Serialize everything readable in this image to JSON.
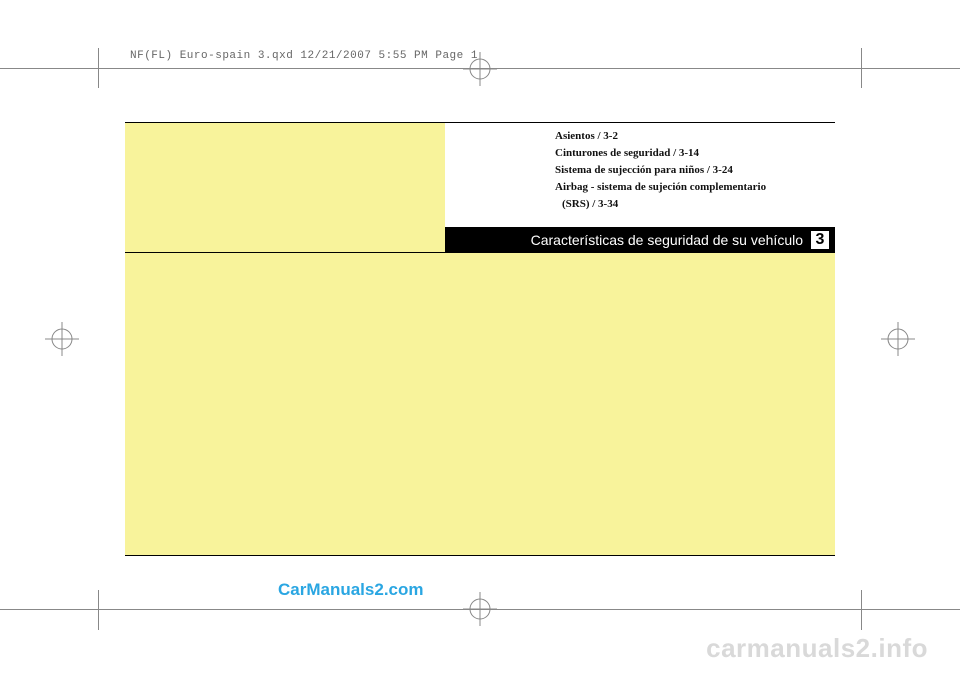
{
  "header": "NF(FL) Euro-spain 3.qxd  12/21/2007  5:55 PM  Page 1",
  "toc": {
    "line1": "Asientos / 3-2",
    "line2": "Cinturones de seguridad / 3-14",
    "line3": "Sistema de sujección para niños / 3-24",
    "line4": "Airbag - sistema de sujeción complementario",
    "line5": "(SRS) / 3-34"
  },
  "chapter": {
    "title": "Características de seguridad de su vehículo",
    "number": "3"
  },
  "watermark1": "CarManuals2.com",
  "watermark2": "carmanuals2.info"
}
